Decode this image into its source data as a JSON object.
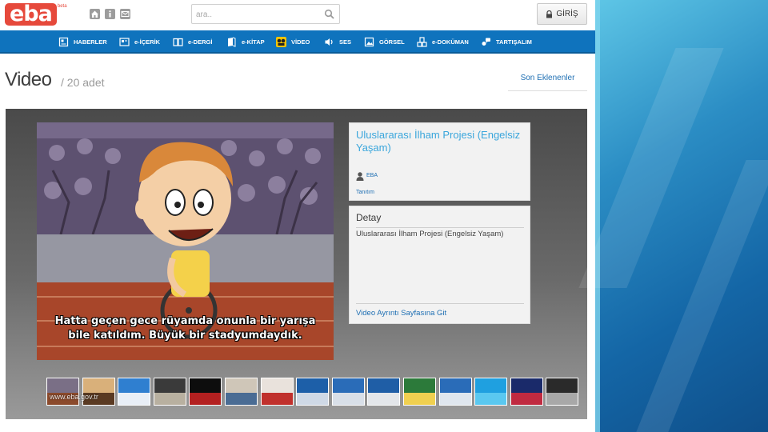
{
  "logo": {
    "text": "eba",
    "tag": "beta"
  },
  "top_icons": [
    "home-icon",
    "info-icon",
    "mail-icon"
  ],
  "search": {
    "placeholder": "ara..",
    "icon": "search-icon"
  },
  "login": {
    "label": "GİRİŞ",
    "icon": "lock-icon"
  },
  "nav": {
    "items": [
      {
        "label": "HABERLER",
        "icon": "newspaper-icon"
      },
      {
        "label": "e-İÇERİK",
        "icon": "content-icon"
      },
      {
        "label": "e-DERGİ",
        "icon": "magazine-icon"
      },
      {
        "label": "e-KİTAP",
        "icon": "book-icon"
      },
      {
        "label": "VİDEO",
        "icon": "film-reel-icon",
        "active": true
      },
      {
        "label": "SES",
        "icon": "speaker-icon"
      },
      {
        "label": "GÖRSEL",
        "icon": "image-icon"
      },
      {
        "label": "e-DOKÜMAN",
        "icon": "document-icon"
      },
      {
        "label": "TARTIŞALIM",
        "icon": "discussion-icon"
      }
    ]
  },
  "page": {
    "title": "Video",
    "count": "/ 20 adet",
    "recent_link": "Son Eklenenler"
  },
  "player": {
    "subtitle_line1": "Hatta geçen gece rüyamda onunla bir yarışa",
    "subtitle_line2": "bile katıldım. Büyük bir stadyumdaydık."
  },
  "info": {
    "title": "Uluslararası İlham Projesi (Engelsiz Yaşam)",
    "uploader": "EBA",
    "uploader_icon": "user-icon",
    "intro_link": "Tanıtım"
  },
  "detail": {
    "heading": "Detay",
    "text": "Uluslararası İlham Projesi (Engelsiz Yaşam)",
    "link": "Video Ayrıntı Sayfasına Git"
  },
  "watermark": "www.eba.gov.tr",
  "thumbnails": [
    {
      "top": "#7a6f86",
      "bottom": "#8b4a2c"
    },
    {
      "top": "#d9b07a",
      "bottom": "#5a3a22"
    },
    {
      "top": "#2f7fd0",
      "bottom": "#e8eef6"
    },
    {
      "top": "#3a3a3a",
      "bottom": "#b8b0a0"
    },
    {
      "top": "#0d0d0d",
      "bottom": "#b32020"
    },
    {
      "top": "#cfc6b8",
      "bottom": "#4a6c94"
    },
    {
      "top": "#e9e2dc",
      "bottom": "#c0302c"
    },
    {
      "top": "#1d5fa8",
      "bottom": "#cfd9e6"
    },
    {
      "top": "#2a6cb8",
      "bottom": "#d8dfe8"
    },
    {
      "top": "#1f5ea6",
      "bottom": "#e3e6ea"
    },
    {
      "top": "#2c7a3a",
      "bottom": "#f0d050"
    },
    {
      "top": "#2a6cb8",
      "bottom": "#dfe6ee"
    },
    {
      "top": "#1fa0e0",
      "bottom": "#5ac8f0"
    },
    {
      "top": "#1a2a6a",
      "bottom": "#c02a40"
    },
    {
      "top": "#2a2a2a",
      "bottom": "#a8a8a8"
    }
  ],
  "colors": {
    "nav": "#0f73bd",
    "accent": "#e6493b",
    "link": "#1e6fb3",
    "title": "#3aa6dc"
  }
}
